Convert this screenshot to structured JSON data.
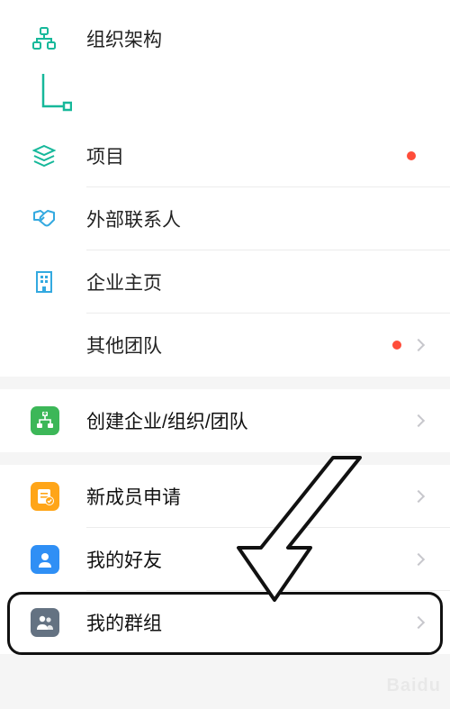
{
  "section1": {
    "items": [
      {
        "label": "组织架构",
        "icon": "org-icon"
      },
      {
        "label": "项目",
        "icon": "layers-icon",
        "dot": true
      },
      {
        "label": "外部联系人",
        "icon": "handshake-icon"
      },
      {
        "label": "企业主页",
        "icon": "building-icon"
      },
      {
        "label": "其他团队",
        "icon": "none",
        "dot": true,
        "chevron": true
      }
    ]
  },
  "section2": {
    "items": [
      {
        "label": "创建企业/组织/团队",
        "icon": "create-org-icon",
        "chevron": true
      }
    ]
  },
  "section3": {
    "items": [
      {
        "label": "新成员申请",
        "icon": "member-request-icon",
        "chevron": true
      },
      {
        "label": "我的好友",
        "icon": "friend-icon",
        "chevron": true
      },
      {
        "label": "我的群组",
        "icon": "group-icon",
        "chevron": true
      }
    ]
  },
  "colors": {
    "teal": "#16b89a",
    "blue": "#2f8ff5",
    "lightblue": "#33a9e0",
    "green": "#3cb758",
    "orange": "#ffa518",
    "slate": "#647282",
    "red": "#ff4d3a"
  }
}
